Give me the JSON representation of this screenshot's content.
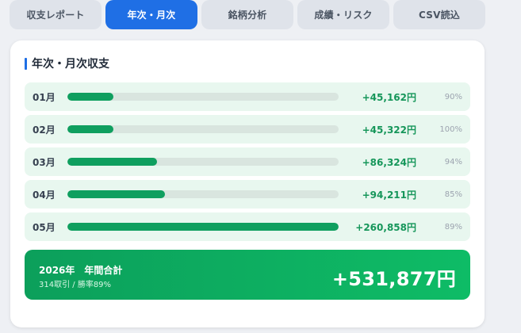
{
  "tabs": [
    {
      "label": "収支レポート",
      "active": false
    },
    {
      "label": "年次・月次",
      "active": true
    },
    {
      "label": "銘柄分析",
      "active": false
    },
    {
      "label": "成績・リスク",
      "active": false
    },
    {
      "label": "CSV読込",
      "active": false
    }
  ],
  "section": {
    "title": "年次・月次収支"
  },
  "colors": {
    "accent_blue": "#1f6fe5",
    "profit_green": "#16965a",
    "bar_fill": "#0f9f5f",
    "row_bg": "#e8f7ef"
  },
  "months": [
    {
      "month": "01月",
      "amount": "+45,162円",
      "win_rate": "90%",
      "bar_fraction": 0.17
    },
    {
      "month": "02月",
      "amount": "+45,322円",
      "win_rate": "100%",
      "bar_fraction": 0.17
    },
    {
      "month": "03月",
      "amount": "+86,324円",
      "win_rate": "94%",
      "bar_fraction": 0.331
    },
    {
      "month": "04月",
      "amount": "+94,211円",
      "win_rate": "85%",
      "bar_fraction": 0.361
    },
    {
      "month": "05月",
      "amount": "+260,858円",
      "win_rate": "89%",
      "bar_fraction": 1.0
    }
  ],
  "total": {
    "year": "2026年",
    "label": "年間合計",
    "sub": "314取引 / 勝率89%",
    "amount": "+531,877円"
  }
}
